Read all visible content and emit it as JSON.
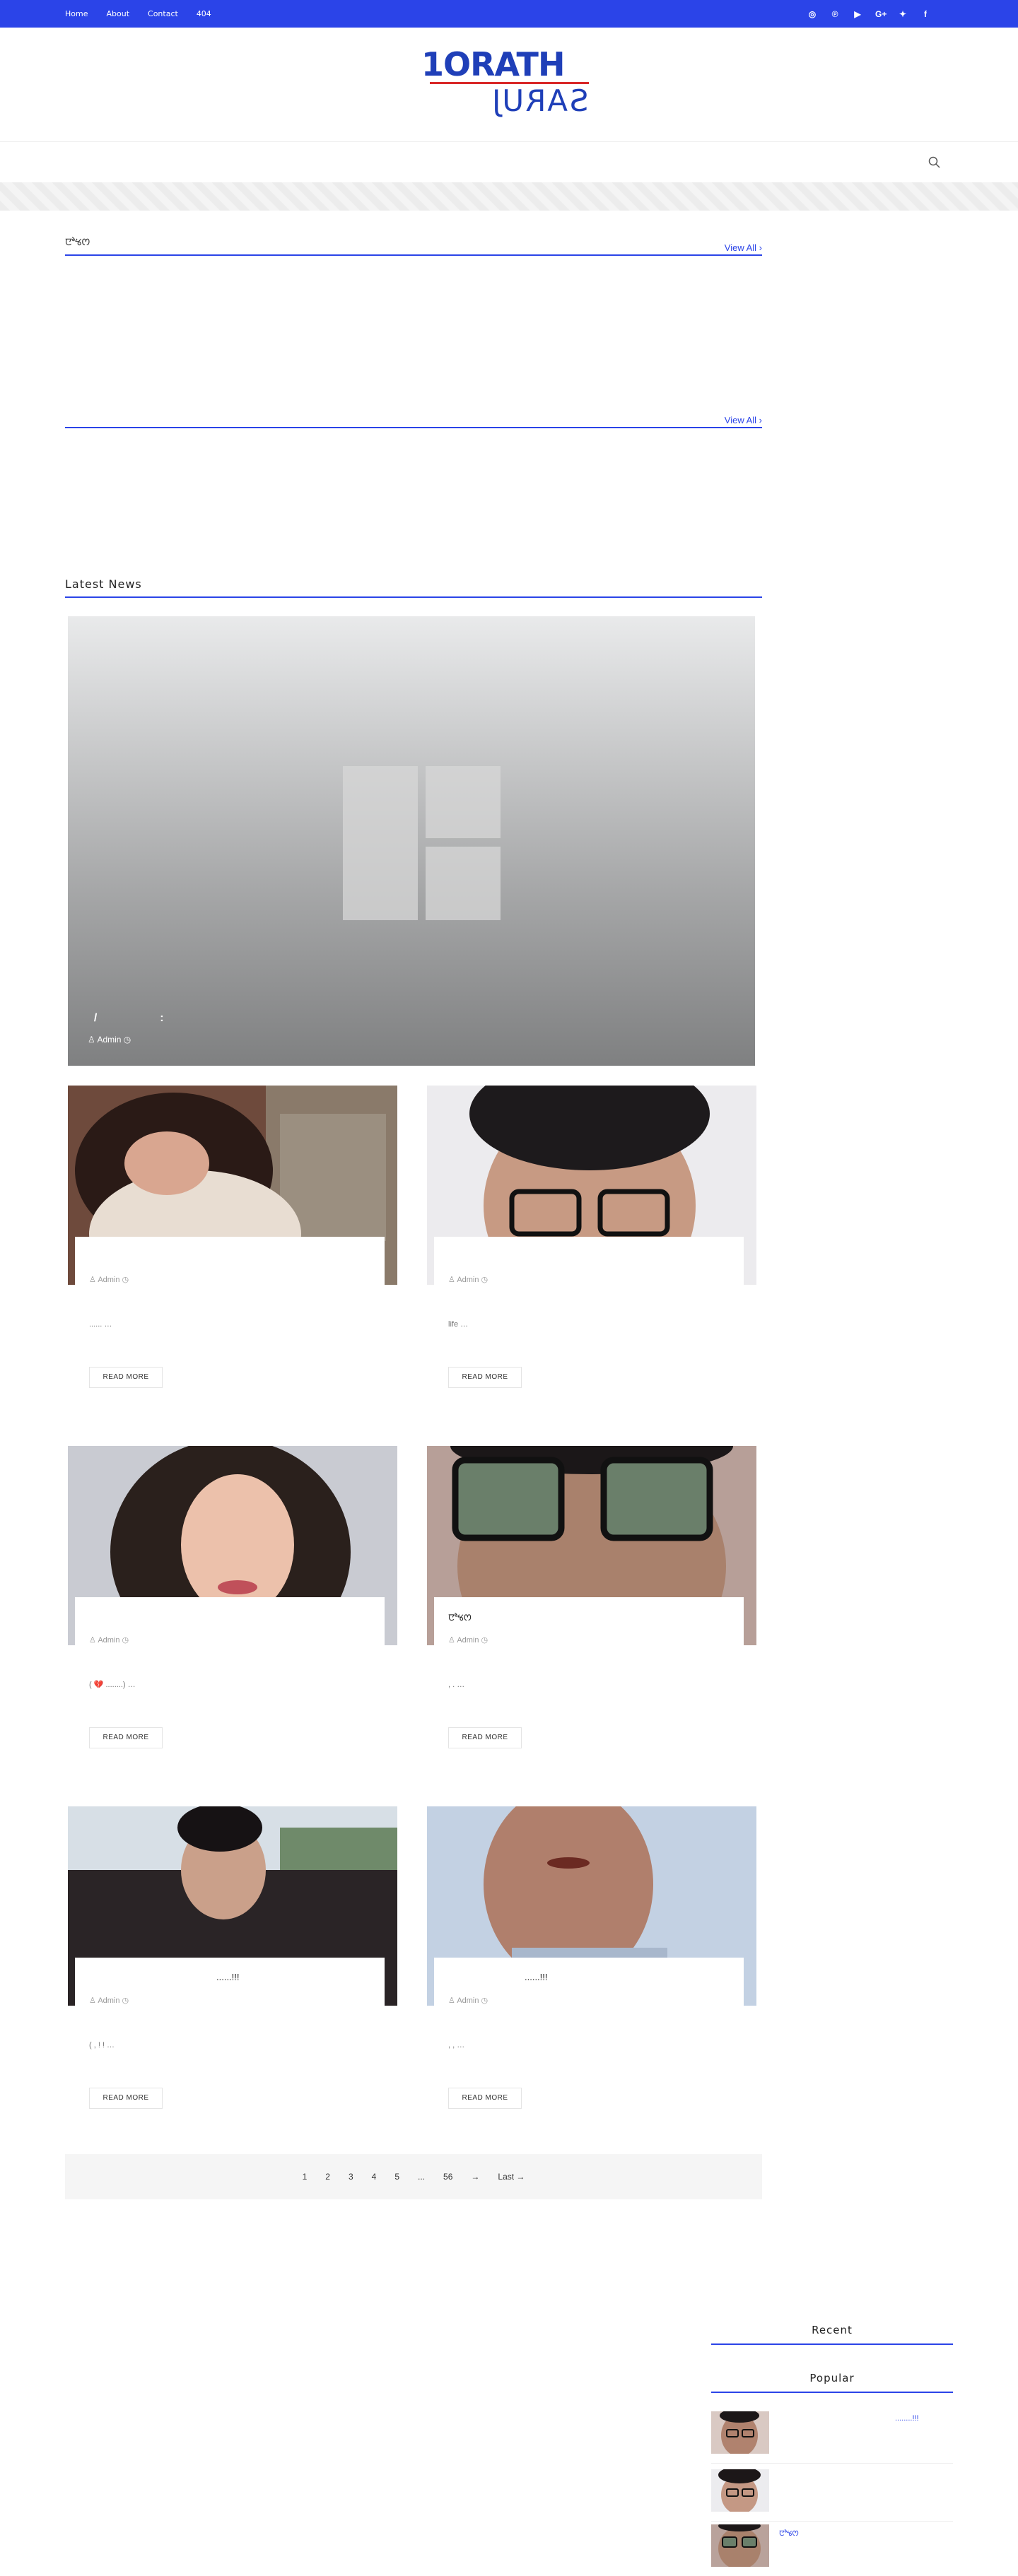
{
  "topbar": {
    "nav": [
      "Home",
      "About",
      "Contact",
      "404"
    ],
    "social": [
      {
        "icon": "instagram-icon",
        "glyph": "◎"
      },
      {
        "icon": "pinterest-icon",
        "glyph": "℗"
      },
      {
        "icon": "youtube-icon",
        "glyph": "▶"
      },
      {
        "icon": "google-plus-icon",
        "glyph": "G+"
      },
      {
        "icon": "twitter-icon",
        "glyph": "✦"
      },
      {
        "icon": "facebook-icon",
        "glyph": "f"
      }
    ]
  },
  "logo": {
    "line1": "1ORATH",
    "line2": "SARUJ"
  },
  "colors": {
    "accent": "#2b44e8",
    "logo_blue": "#1f3fb8",
    "logo_red": "#d92828"
  },
  "sections": {
    "featured": {
      "title": "ꯅꯣꯠꯁ",
      "view_all": "View All ›"
    },
    "second": {
      "title": "",
      "view_all": "View All ›"
    },
    "latest": {
      "title": "Latest News"
    }
  },
  "hero": {
    "title": "  /                    :",
    "author": "Admin"
  },
  "cards": [
    {
      "title": "",
      "author": "Admin",
      "excerpt": "...... …"
    },
    {
      "title": "",
      "author": "Admin",
      "excerpt": "life …"
    },
    {
      "title": "",
      "author": "Admin",
      "excerpt": "( 💔 ........) …"
    },
    {
      "title": "ꯅꯣꯠꯁ",
      "author": "Admin",
      "excerpt": ", . …"
    },
    {
      "title": "......!!!",
      "author": "Admin",
      "excerpt": "( , ! ! …"
    },
    {
      "title": "......!!!",
      "author": "Admin",
      "excerpt": ", , …"
    }
  ],
  "read_more": "READ MORE",
  "pagination": [
    "1",
    "2",
    "3",
    "4",
    "5",
    "...",
    "56",
    "→",
    "Last →"
  ],
  "sidebar": {
    "recent_title": "Recent",
    "popular_title": "Popular",
    "popular": [
      {
        "text": "........!!!"
      },
      {
        "text": ""
      },
      {
        "text": "ꯅꯣꯠꯁ"
      }
    ]
  }
}
